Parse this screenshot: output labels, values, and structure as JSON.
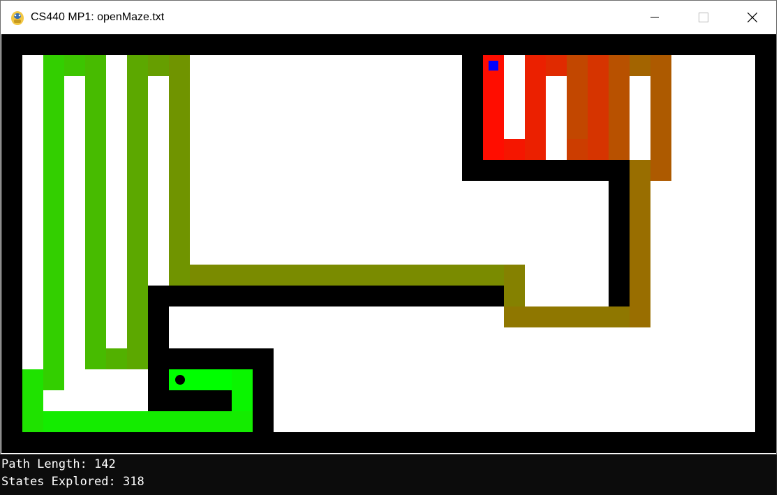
{
  "window": {
    "title": "CS440 MP1: openMaze.txt"
  },
  "icons": {
    "app": "python-app-icon",
    "minimize": "minimize-icon",
    "maximize": "maximize-icon",
    "close": "close-icon"
  },
  "maze": {
    "cell_size": 30,
    "wall_color": "#000000",
    "open_color": "#ffffff",
    "path_start_color": "#00ff00",
    "path_end_color": "#ff0000",
    "agent_color": "#0000ff",
    "goal_color": "#000000",
    "rows": [
      "%%%%%%%%%%%%%%%%%%%%%%%%%%%%%%%%%%%%%",
      "%                      %    . .      %",
      "%                      %  . . . .    %",
      "%                      %  . . . .    %",
      "%                      %  . . . .    %",
      "%                      %%%%%%% %%    %",
      "%                            % %    %",
      "%                            % %    %",
      "%                            % %    %",
      "%                            % %    %",
      "%                            % %    %",
      "%      %%%%%%%%%%%%%%%%%%%%%%% %    %",
      "%      %                            %",
      "%      %                            %",
      "%      %%%%%                        %",
      "%      %   %                        %",
      "%      %%%% %                       %",
      "%          %                        %",
      "%          %                        %",
      "%%%%%%%%%%%%%%%%%%%%%%%%%%%%%%%%%%%%%"
    ]
  },
  "stats": {
    "path_length": "Path Length: 142",
    "states_explored": "States Explored: 318"
  }
}
